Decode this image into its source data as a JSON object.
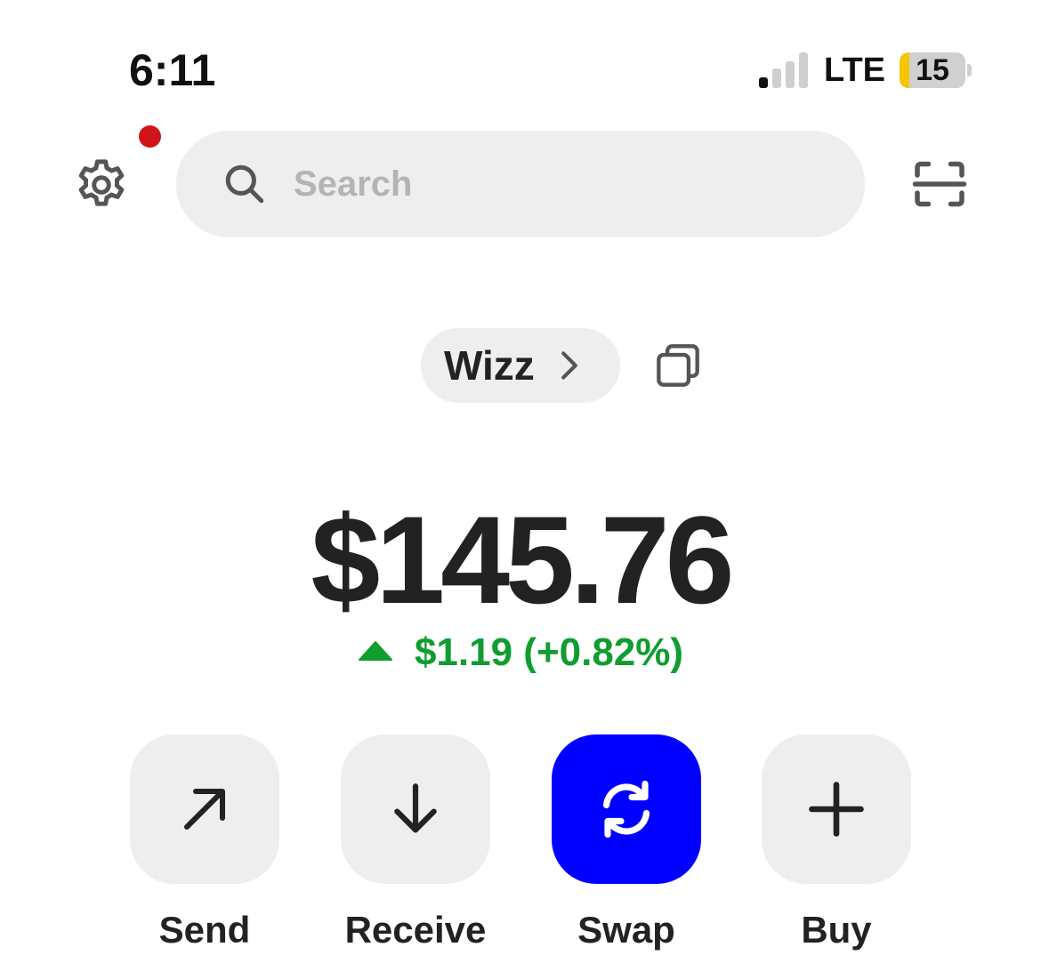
{
  "status_bar": {
    "time": "6:11",
    "network": "LTE",
    "battery_level": "15",
    "battery_fraction": 0.15,
    "signal_bars_active": 1,
    "signal_bars_total": 4
  },
  "top_bar": {
    "settings_icon": "gear-icon",
    "has_notification": true,
    "notification_color": "#d0151a",
    "search": {
      "placeholder": "Search",
      "value": "",
      "icon": "search-icon"
    },
    "scan_icon": "scan-icon"
  },
  "account": {
    "name": "Wizz",
    "chevron_icon": "chevron-right-icon",
    "copy_icon": "copy-icon"
  },
  "balance": {
    "amount": "$145.76",
    "change_text": "$1.19 (+0.82%)",
    "direction": "up",
    "change_color": "#0f9d2f"
  },
  "actions": [
    {
      "label": "Send",
      "icon": "arrow-up-right-icon",
      "primary": false
    },
    {
      "label": "Receive",
      "icon": "arrow-down-icon",
      "primary": false
    },
    {
      "label": "Swap",
      "icon": "swap-icon",
      "primary": true
    },
    {
      "label": "Buy",
      "icon": "plus-icon",
      "primary": false
    }
  ],
  "colors": {
    "accent": "#0000ff",
    "tile_background": "#eeeeee",
    "text": "#222222"
  }
}
